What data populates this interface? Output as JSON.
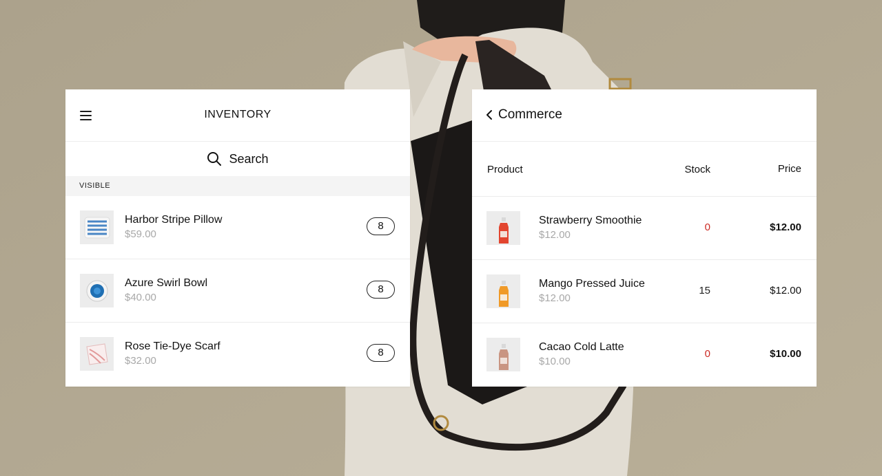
{
  "inventory": {
    "title": "INVENTORY",
    "search_label": "Search",
    "section_label": "VISIBLE",
    "items": [
      {
        "name": "Harbor Stripe Pillow",
        "price": "$59.00",
        "qty": "8"
      },
      {
        "name": "Azure Swirl Bowl",
        "price": "$40.00",
        "qty": "8"
      },
      {
        "name": "Rose Tie-Dye Scarf",
        "price": "$32.00",
        "qty": "8"
      }
    ]
  },
  "commerce": {
    "title": "Commerce",
    "columns": {
      "product": "Product",
      "stock": "Stock",
      "price": "Price"
    },
    "rows": [
      {
        "name": "Strawberry Smoothie",
        "sub_price": "$12.00",
        "stock": "0",
        "price": "$12.00"
      },
      {
        "name": "Mango Pressed Juice",
        "sub_price": "$12.00",
        "stock": "15",
        "price": "$12.00"
      },
      {
        "name": "Cacao Cold Latte",
        "sub_price": "$10.00",
        "stock": "0",
        "price": "$10.00"
      }
    ]
  },
  "colors": {
    "background": "#b3a994",
    "out_of_stock": "#cc2a24",
    "muted_text": "#a8a8a8"
  },
  "icons": {
    "menu": "hamburger-menu-icon",
    "search": "search-icon",
    "back": "chevron-left-icon"
  }
}
